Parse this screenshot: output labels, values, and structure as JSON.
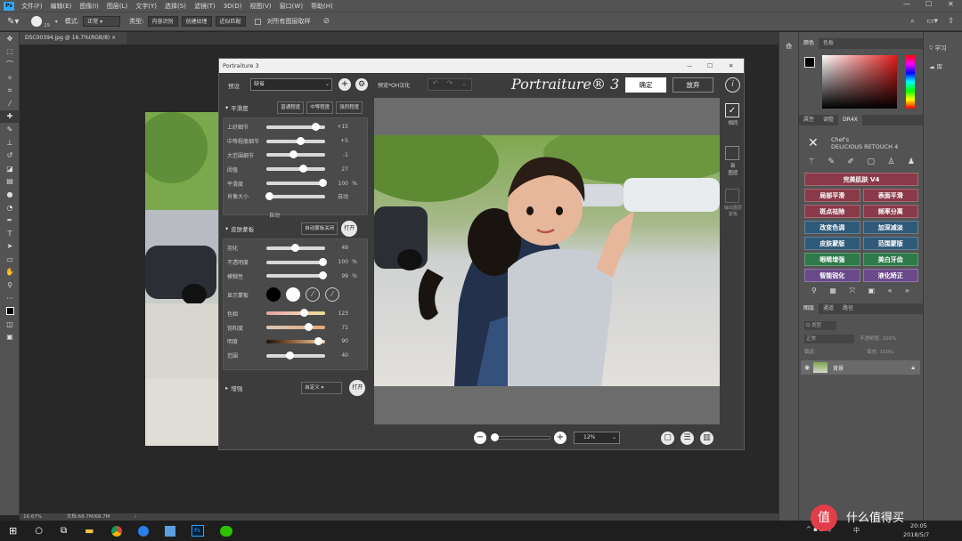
{
  "menubar": {
    "logo": "Ps",
    "items": [
      "文件(F)",
      "编辑(E)",
      "图像(I)",
      "图层(L)",
      "文字(Y)",
      "选择(S)",
      "滤镜(T)",
      "3D(D)",
      "视图(V)",
      "窗口(W)",
      "帮助(H)"
    ]
  },
  "options": {
    "brush_size": "29",
    "mode_label": "模式:",
    "mode_value": "正常",
    "type_label": "类型:",
    "btn_content": "内容识别",
    "btn_texture": "创建纹理",
    "btn_proximity": "近似匹配",
    "sample_all": "对所有图层取样"
  },
  "doc_tab": "DSC00394.jpg @ 16.7%(RGB/8)",
  "status": {
    "zoom": "16.67%",
    "doc": "文档:68.7M/68.7M"
  },
  "dialog": {
    "title": "Portraiture 3",
    "preset_label": "预设",
    "preset_value": "缺省",
    "preview_label": "预览*OH汉化",
    "brand": "Portraiture® 3",
    "ok": "确定",
    "cancel": "放弃",
    "smoothing": {
      "title": "平滑度",
      "btn_normal": "普通程度",
      "btn_medium": "中等程度",
      "btn_strong": "强烈程度",
      "sliders": [
        {
          "name": "上好细节",
          "value": "+15",
          "pos": 0.83
        },
        {
          "name": "中等程度细节",
          "value": "+5",
          "pos": 0.58
        },
        {
          "name": "大范围细节",
          "value": "-1",
          "pos": 0.46
        },
        {
          "name": "阈值",
          "value": "27",
          "pos": 0.62
        },
        {
          "name": "平滑度",
          "value": "100",
          "unit": "%",
          "pos": 0.95
        },
        {
          "name": "肖像大小",
          "value": "自动",
          "pos": 0.05
        }
      ],
      "auto_label": "自动"
    },
    "skin": {
      "title": "皮肤蒙板",
      "btn_auto": "自动蒙板关闭",
      "open": "打开",
      "sliders": [
        {
          "name": "羽化",
          "value": "49",
          "pos": 0.49
        },
        {
          "name": "不透明度",
          "value": "100",
          "unit": "%",
          "pos": 0.95
        },
        {
          "name": "模糊性",
          "value": "99",
          "unit": "%",
          "pos": 0.95
        }
      ],
      "display_label": "显示蒙板",
      "color_sliders": [
        {
          "name": "色相",
          "value": "123",
          "pos": 0.63
        },
        {
          "name": "饱和度",
          "value": "71",
          "pos": 0.71
        },
        {
          "name": "明度",
          "value": "90",
          "pos": 0.88
        },
        {
          "name": "范围",
          "value": "40",
          "pos": 0.4
        }
      ]
    },
    "enhance": {
      "title": "增强",
      "btn": "自定义",
      "open": "打开"
    },
    "zoom_value": "12%",
    "right_tools": {
      "same": "相同",
      "new_layer": "新\n图层",
      "output_mask": "输出图层\n蒙板"
    }
  },
  "rpanel": {
    "color_tabs": [
      "颜色",
      "色板"
    ],
    "adj_tabs": [
      "属性",
      "调整",
      "DR4X"
    ],
    "dr4_title1": "Chef's",
    "dr4_title2": "DELICIOUS RETOUCH 4",
    "buttons": [
      {
        "label": "完美肌肤 V4",
        "color": "#8a3a48"
      },
      {
        "label": "局部平滑",
        "color": "#8a3a48"
      },
      {
        "label": "表面平滑",
        "color": "#8a3a48"
      },
      {
        "label": "斑点祛除",
        "color": "#8a3a48"
      },
      {
        "label": "频率分离",
        "color": "#8a3a48"
      },
      {
        "label": "改变色调",
        "color": "#2f5a7a"
      },
      {
        "label": "加深减淡",
        "color": "#2f5a7a"
      },
      {
        "label": "皮肤蒙版",
        "color": "#2f5a7a"
      },
      {
        "label": "范围蒙版",
        "color": "#2f5a7a"
      },
      {
        "label": "眼睛增强",
        "color": "#2f7a4a"
      },
      {
        "label": "美白牙齿",
        "color": "#2f7a4a"
      },
      {
        "label": "智能锐化",
        "color": "#6a4a8a"
      },
      {
        "label": "液化矫正",
        "color": "#6a4a8a"
      }
    ],
    "layer_tabs": [
      "图层",
      "通道",
      "路径"
    ],
    "layer_kind": "Q 类型",
    "blend": "正常",
    "opacity": "不透明度: 100%",
    "lock": "锁定:",
    "fill": "填充: 100%",
    "layer_name": "背景"
  },
  "rstrip2": {
    "learn": "学习",
    "lib": "库"
  },
  "taskbar": {
    "time": "20:05",
    "date": "2018/5/7",
    "lang": "中",
    "watermark": "什么值得买"
  }
}
